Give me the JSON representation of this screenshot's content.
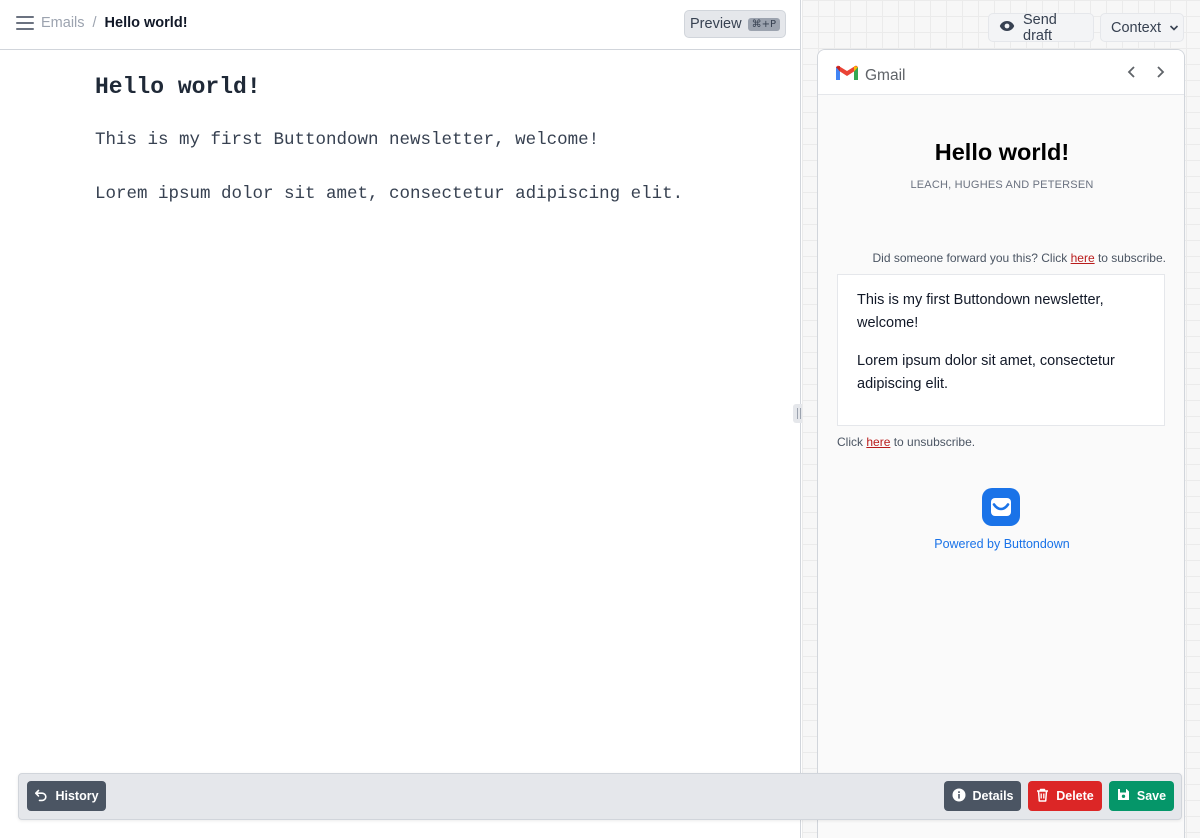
{
  "breadcrumb": {
    "parent": "Emails",
    "separator": "/",
    "current": "Hello world!"
  },
  "toolbar": {
    "preview_label": "Preview",
    "preview_shortcut": "⌘+P"
  },
  "editor": {
    "title": "Hello world!",
    "paragraphs": [
      "This is my first Buttondown newsletter, welcome!",
      "Lorem ipsum dolor sit amet, consectetur adipiscing elit."
    ]
  },
  "preview": {
    "send_draft_label": "Send draft",
    "context_label": "Context",
    "client_name": "Gmail",
    "email": {
      "title": "Hello world!",
      "organization": "LEACH, HUGHES AND PETERSEN",
      "forward_prefix": "Did someone forward you this? Click ",
      "forward_link": "here",
      "forward_suffix": " to subscribe.",
      "body": [
        "This is my first Buttondown newsletter, welcome!",
        "Lorem ipsum dolor sit amet, consectetur adipiscing elit."
      ],
      "unsub_prefix": "Click ",
      "unsub_link": "here",
      "unsub_suffix": " to unsubscribe.",
      "powered_by": "Powered by Buttondown"
    }
  },
  "actions": {
    "history_label": "History",
    "details_label": "Details",
    "delete_label": "Delete",
    "save_label": "Save"
  },
  "colors": {
    "delete": "#dc2626",
    "save": "#059669",
    "secondary": "#4b5563",
    "link_red": "#b91c1c",
    "buttondown_blue": "#1a73e8"
  },
  "icons": [
    "hamburger-menu-icon",
    "eye-icon",
    "chevron-down-icon",
    "gmail-logo-icon",
    "chevron-left-icon",
    "chevron-right-icon",
    "buttondown-logo-icon",
    "undo-arrow-icon",
    "info-icon",
    "trash-icon",
    "floppy-disk-icon"
  ]
}
